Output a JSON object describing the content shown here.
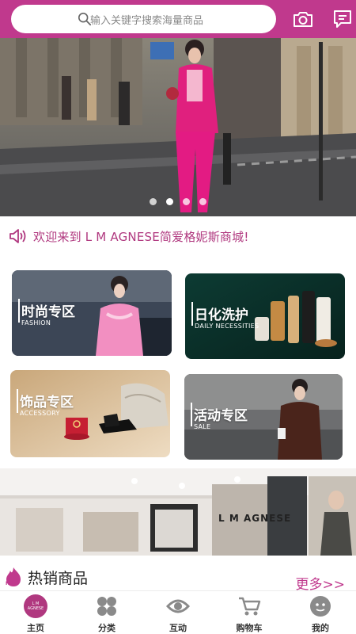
{
  "search": {
    "placeholder": "输入关键字搜索海量商品",
    "search_icon": "search-icon"
  },
  "header_icons": {
    "camera": "camera-icon",
    "message": "message-icon"
  },
  "banner": {
    "slide_count": 4,
    "active_slide": 1
  },
  "notice": {
    "icon": "speaker-icon",
    "text": "欢迎来到 L M AGNESE简爱格妮斯商城!"
  },
  "categories": [
    {
      "title": "时尚专区",
      "subtitle": "FASHION"
    },
    {
      "title": "日化洗护",
      "subtitle": "DAILY NECESSITIES"
    },
    {
      "title": "饰品专区",
      "subtitle": "ACCESSORY"
    },
    {
      "title": "活动专区",
      "subtitle": "SALE"
    }
  ],
  "store": {
    "sign": "L M AGNESE"
  },
  "hot": {
    "badge": "HOT",
    "title": "热销商品",
    "more": "更多>>"
  },
  "nav": {
    "items": [
      {
        "label": "主页",
        "icon": "home-logo-icon",
        "logo_text": "L M AGNESE"
      },
      {
        "label": "分类",
        "icon": "category-icon"
      },
      {
        "label": "互动",
        "icon": "eye-icon"
      },
      {
        "label": "购物车",
        "icon": "cart-icon"
      },
      {
        "label": "我的",
        "icon": "profile-icon"
      }
    ]
  },
  "colors": {
    "brand": "#c0398d",
    "accent_text": "#b0387f"
  }
}
